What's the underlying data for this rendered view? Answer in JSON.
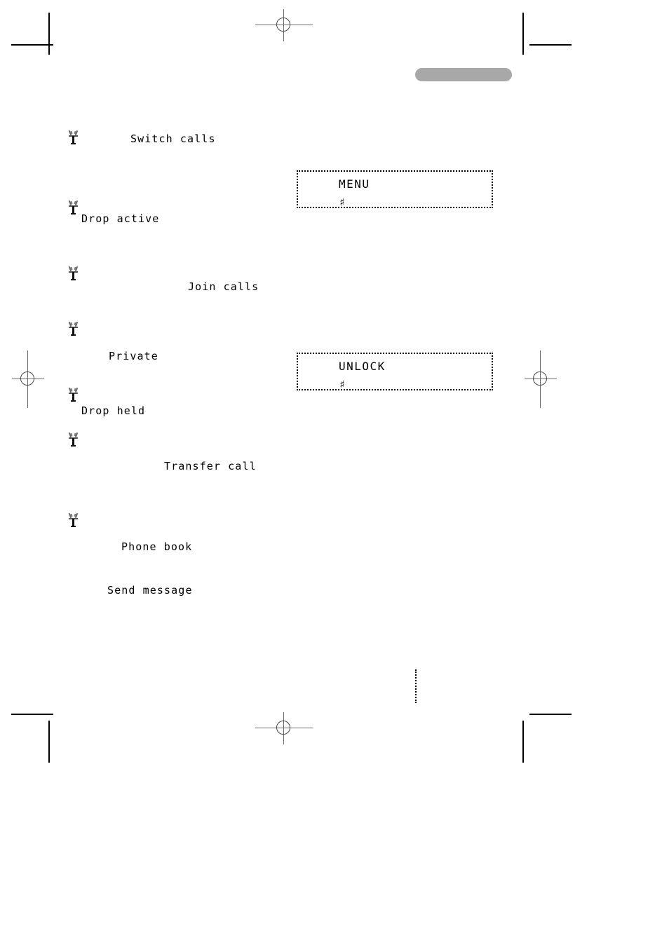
{
  "document": {
    "type": "printed-manual-page",
    "background_color": "#ffffff"
  },
  "header": {
    "tab_label": "",
    "tab_color": "#a8a8a8"
  },
  "menu_items": [
    {
      "icon": "antenna-icon",
      "label": "Switch calls"
    },
    {
      "icon": "antenna-icon",
      "label": "Drop active"
    },
    {
      "icon": "antenna-icon",
      "label": "Join calls"
    },
    {
      "icon": "antenna-icon",
      "label": "Private"
    },
    {
      "icon": "antenna-icon",
      "label": "Drop held"
    },
    {
      "icon": "antenna-icon",
      "label": "Transfer call"
    },
    {
      "icon": "antenna-icon",
      "label": "Phone book"
    },
    {
      "icon": "",
      "label": "Send message"
    }
  ],
  "displays": [
    {
      "name": "menu-display",
      "line1": "MENU",
      "line2": "♯"
    },
    {
      "name": "unlock-display",
      "line1": "UNLOCK",
      "line2": "♯"
    }
  ],
  "print_marks": {
    "crop_marks": 8,
    "registration_targets": 4,
    "margin_dot_rule": true
  }
}
